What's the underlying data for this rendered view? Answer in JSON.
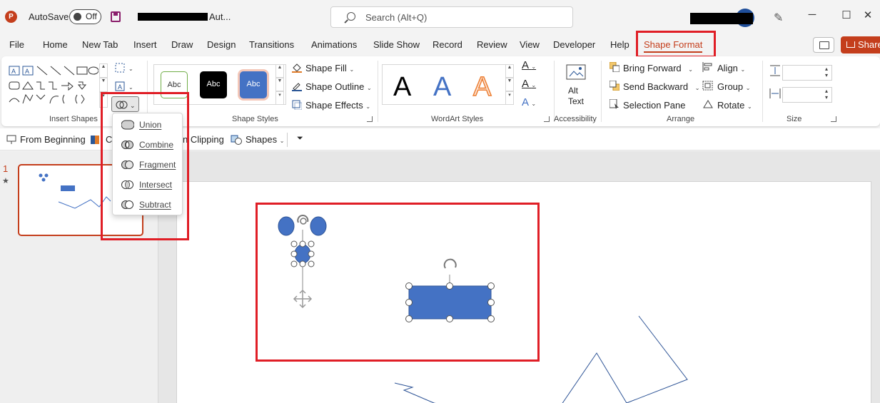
{
  "titlebar": {
    "app_logo": "P",
    "autosave_label": "AutoSave",
    "autosave_state": "Off",
    "file_name_suffix": "Aut...",
    "search_placeholder": "Search (Alt+Q)",
    "minimize_glyph": "─",
    "maximize_glyph": "☐",
    "close_glyph": "✕"
  },
  "tabs": [
    {
      "label": "File"
    },
    {
      "label": "Home"
    },
    {
      "label": "New Tab"
    },
    {
      "label": "Insert"
    },
    {
      "label": "Draw"
    },
    {
      "label": "Design"
    },
    {
      "label": "Transitions"
    },
    {
      "label": "Animations"
    },
    {
      "label": "Slide Show"
    },
    {
      "label": "Record"
    },
    {
      "label": "Review"
    },
    {
      "label": "View"
    },
    {
      "label": "Developer"
    },
    {
      "label": "Help"
    },
    {
      "label": "Shape Format"
    }
  ],
  "share_label": "Share",
  "ribbon": {
    "insert_shapes_label": "Insert Shapes",
    "shape_styles_label": "Shape Styles",
    "style_samples": [
      "Abc",
      "Abc",
      "Abc"
    ],
    "shape_fill": "Shape Fill",
    "shape_outline": "Shape Outline",
    "shape_effects": "Shape Effects",
    "wordart_label": "WordArt Styles",
    "wordart_letters": [
      "A",
      "A",
      "A"
    ],
    "accessibility_label": "Accessibility",
    "alt_text_line1": "Alt",
    "alt_text_line2": "Text",
    "arrange_label": "Arrange",
    "bring_forward": "Bring Forward",
    "send_backward": "Send Backward",
    "selection_pane": "Selection Pane",
    "align": "Align",
    "group": "Group",
    "rotate": "Rotate",
    "size_label": "Size"
  },
  "merge_menu": {
    "items": [
      {
        "label": "Union"
      },
      {
        "label": "Combine"
      },
      {
        "label": "Fragment"
      },
      {
        "label": "Intersect"
      },
      {
        "label": "Subtract"
      }
    ]
  },
  "qat": {
    "from_beginning": "From Beginning",
    "partial_left": "C",
    "clipping": "n Clipping",
    "shapes": "Shapes"
  },
  "slides_pane": {
    "slide_number": "1",
    "star": "★"
  },
  "colors": {
    "accent": "#c43e1c",
    "shape_fill": "#4472c4",
    "highlight": "#e01e26"
  }
}
